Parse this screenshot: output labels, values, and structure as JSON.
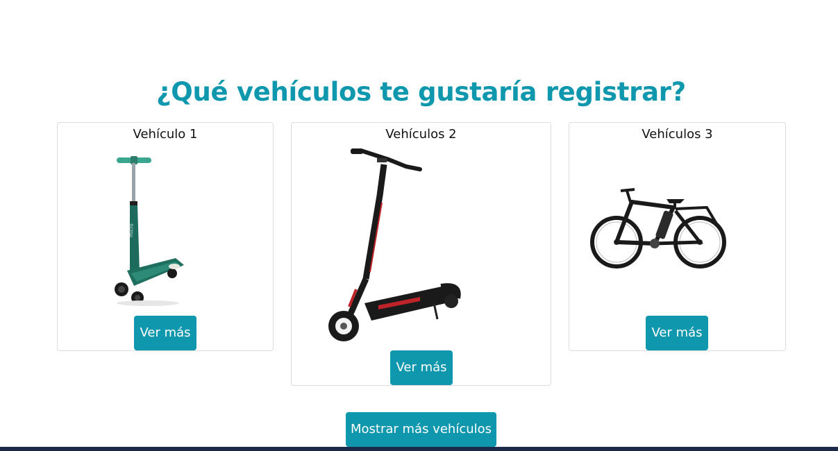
{
  "heading": "¿Qué vehículos te gustaría registrar?",
  "cards": [
    {
      "title": "Vehículo 1",
      "button": "Ver más",
      "image": "kick-scooter"
    },
    {
      "title": "Vehículos 2",
      "button": "Ver más",
      "image": "electric-scooter"
    },
    {
      "title": "Vehículos 3",
      "button": "Ver más",
      "image": "electric-bicycle"
    }
  ],
  "more_button": "Mostrar más vehículos",
  "colors": {
    "accent": "#0e97ad",
    "card_border": "#dcdcdc",
    "taskbar": "#1c2a4a"
  }
}
